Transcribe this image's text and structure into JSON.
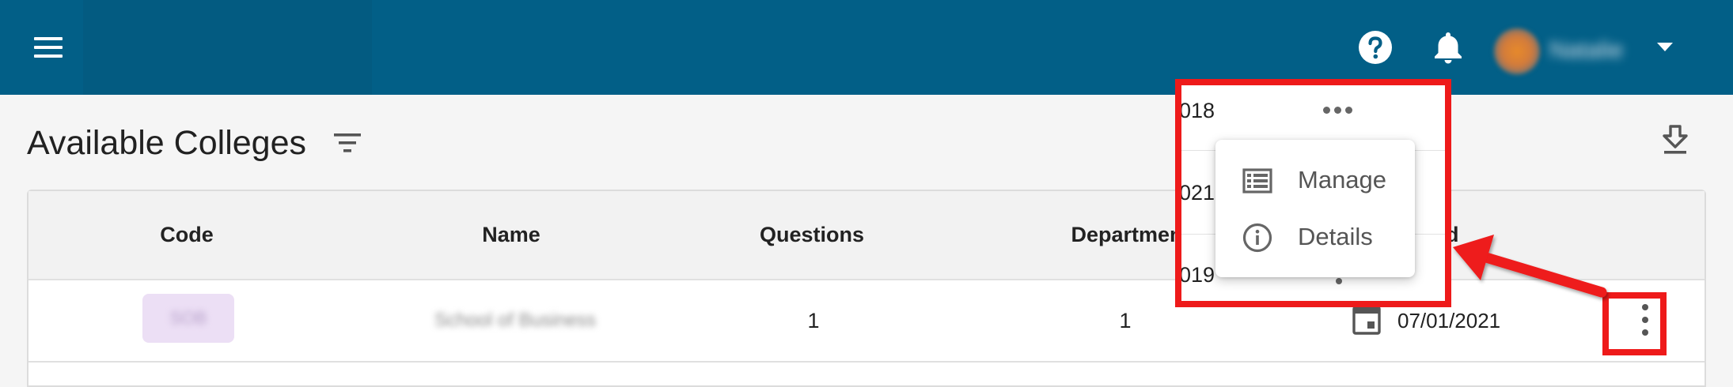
{
  "header": {
    "user_name": "Natalie",
    "icons": [
      "menu-icon",
      "help-icon",
      "bell-icon",
      "caret-down-icon"
    ]
  },
  "page": {
    "title": "Available Colleges",
    "icons": [
      "filter-icon",
      "download-icon"
    ]
  },
  "table": {
    "columns": [
      "Code",
      "Name",
      "Questions",
      "Departments",
      "ed"
    ],
    "rows": [
      {
        "code": "SOB",
        "name": "School of Business",
        "questions": "1",
        "departments": "1",
        "date": "07/01/2021"
      }
    ]
  },
  "inset": {
    "fragments": [
      "018",
      "021",
      "019"
    ],
    "menu": {
      "items": [
        {
          "label": "Manage",
          "icon": "list-icon"
        },
        {
          "label": "Details",
          "icon": "info-icon"
        }
      ]
    }
  },
  "annotation": {
    "color": "#ee1a1a"
  },
  "colors": {
    "header_bg": "#025f87",
    "chip_bg": "#ecdff5"
  }
}
